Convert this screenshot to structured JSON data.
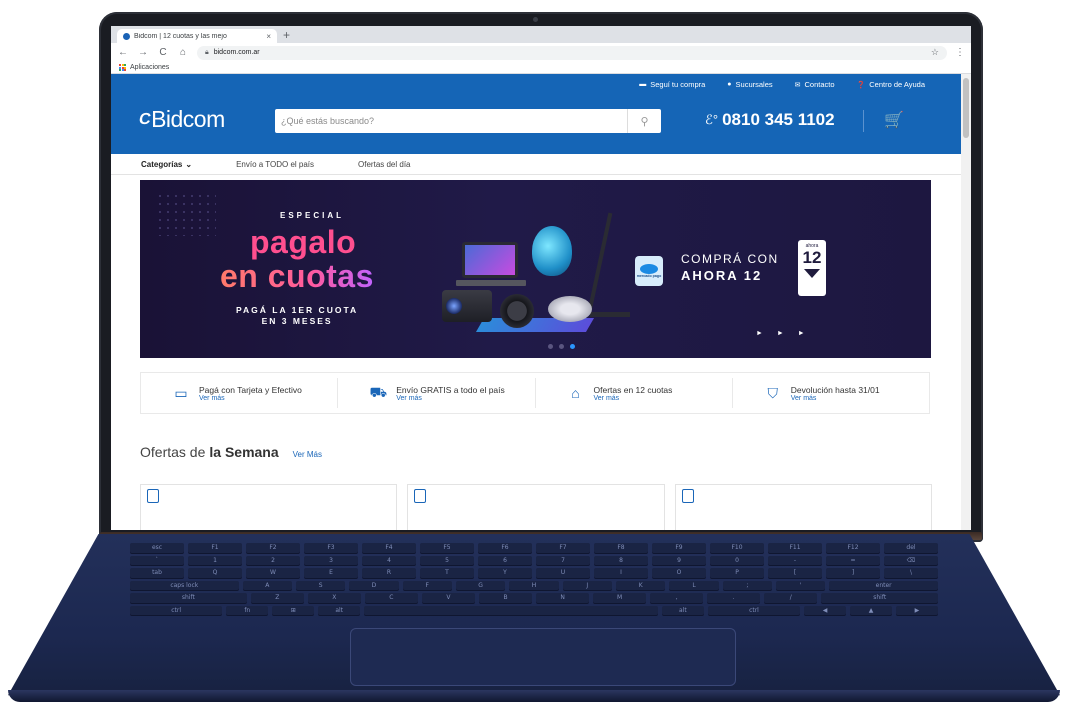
{
  "browser": {
    "tab_title": "Bidcom | 12 cuotas y las mejo",
    "tab_close": "×",
    "new_tab": "+",
    "url": "bidcom.com.ar",
    "nav": {
      "back": "←",
      "forward": "→",
      "reload": "C",
      "home": "⌂"
    },
    "bookmarks_label": "Aplicaciones",
    "star": "☆",
    "menu": "⋮"
  },
  "header": {
    "topnav": [
      {
        "label": "Seguí tu compra",
        "icon": "truck-icon",
        "glyph": "▬"
      },
      {
        "label": "Sucursales",
        "icon": "pin-icon",
        "glyph": "●"
      },
      {
        "label": "Contacto",
        "icon": "mail-icon",
        "glyph": "✉"
      },
      {
        "label": "Centro de Ayuda",
        "icon": "help-icon",
        "glyph": "❓"
      }
    ],
    "logo_mark": "C",
    "logo_text": "Bidcom",
    "search_placeholder": "¿Qué estás buscando?",
    "search_icon": "⚲",
    "phone_icon": "ℰ°",
    "phone": "0810 345 1102",
    "cart_icon": "🛒"
  },
  "catbar": {
    "categories_label": "Categorías",
    "categories_chevron": "⌄",
    "links": [
      "Envío a TODO el país",
      "Ofertas del día"
    ]
  },
  "banner": {
    "especial": "ESPECIAL",
    "line1": "pagalo",
    "line2": "en cuotas",
    "sub1": "PAGÁ LA 1ER CUOTA",
    "sub2": "EN 3 MESES",
    "mp_label": "mercado pago",
    "compra1": "COMPRÁ CON",
    "compra2": "AHORA 12",
    "badge_top": "ahora",
    "badge_num": "12",
    "arrows": "► ► ►",
    "slide_count": 3,
    "active_slide": 3
  },
  "features": [
    {
      "title": "Pagá con Tarjeta y Efectivo",
      "link": "Ver más",
      "icon": "card-icon",
      "glyph": "▭"
    },
    {
      "title": "Envío GRATIS a todo el país",
      "link": "Ver más",
      "icon": "truck-icon",
      "glyph": "⛟"
    },
    {
      "title": "Ofertas en 12 cuotas",
      "link": "Ver más",
      "icon": "tag-icon",
      "glyph": "⌂"
    },
    {
      "title": "Devolución hasta 31/01",
      "link": "Ver más",
      "icon": "shield-check-icon",
      "glyph": "⛉"
    }
  ],
  "week": {
    "title_a": "Ofertas de",
    "title_b": "la Semana",
    "link": "Ver Más"
  },
  "keyboard_rows": [
    [
      "esc",
      "F1",
      "F2",
      "F3",
      "F4",
      "F5",
      "F6",
      "F7",
      "F8",
      "F9",
      "F10",
      "F11",
      "F12",
      "del"
    ],
    [
      "`",
      "1",
      "2",
      "3",
      "4",
      "5",
      "6",
      "7",
      "8",
      "9",
      "0",
      "-",
      "=",
      "⌫"
    ],
    [
      "tab",
      "Q",
      "W",
      "E",
      "R",
      "T",
      "Y",
      "U",
      "I",
      "O",
      "P",
      "[",
      "]",
      "\\"
    ],
    [
      "caps lock",
      "A",
      "S",
      "D",
      "F",
      "G",
      "H",
      "J",
      "K",
      "L",
      ";",
      "'",
      "enter"
    ],
    [
      "shift",
      "Z",
      "X",
      "C",
      "V",
      "B",
      "N",
      "M",
      ",",
      ".",
      "/",
      "shift"
    ],
    [
      "ctrl",
      "fn",
      "⊞",
      "alt",
      "",
      "alt",
      "ctrl",
      "◀",
      "▲",
      "▶"
    ]
  ],
  "colors": {
    "brand_blue": "#1565b6",
    "link_blue": "#1a66b8",
    "laptop_deck": "#1c2850"
  }
}
